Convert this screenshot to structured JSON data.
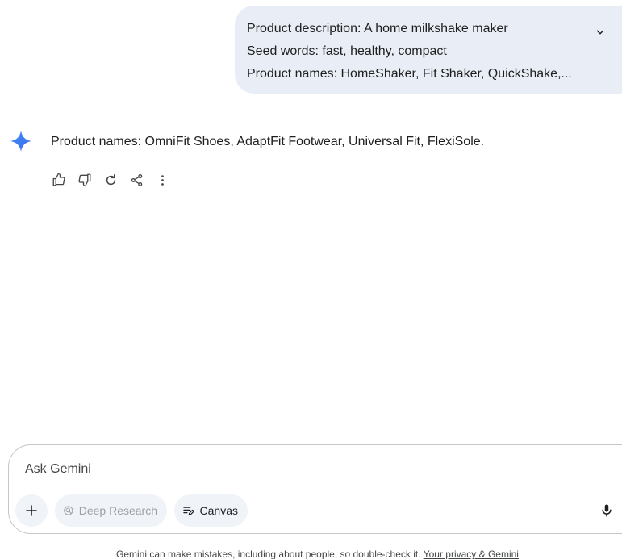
{
  "user_prompt": {
    "lines": [
      "Product description: A home milkshake maker",
      "Seed words: fast, healthy, compact",
      "Product names: HomeShaker, Fit Shaker, QuickShake,..."
    ],
    "expand_icon": "chevron-down-icon"
  },
  "response": {
    "avatar_icon": "gemini-sparkle-icon",
    "text": "Product names: OmniFit Shoes, AdaptFit Footwear, Universal Fit, FlexiSole.",
    "actions": [
      "thumbs-up-icon",
      "thumbs-down-icon",
      "regenerate-icon",
      "share-icon",
      "more-vert-icon"
    ]
  },
  "composer": {
    "placeholder": "Ask Gemini",
    "value": "",
    "add_icon": "plus-icon",
    "tools": [
      {
        "label": "Deep Research",
        "icon": "deep-research-icon",
        "enabled": false
      },
      {
        "label": "Canvas",
        "icon": "canvas-icon",
        "enabled": true
      }
    ],
    "mic_icon": "microphone-icon"
  },
  "footer": {
    "disclaimer": "Gemini can make mistakes, including about people, so double-check it.",
    "link_text": "Your privacy & Gemini"
  },
  "colors": {
    "user_bubble_bg": "#e9eef6",
    "chip_bg": "#f0f4f9",
    "text_primary": "#1f1f1f",
    "text_secondary": "#444746",
    "disabled_text": "#9aa0a6",
    "border": "#c4c7c5",
    "sparkle_blue": "#4285f4"
  }
}
